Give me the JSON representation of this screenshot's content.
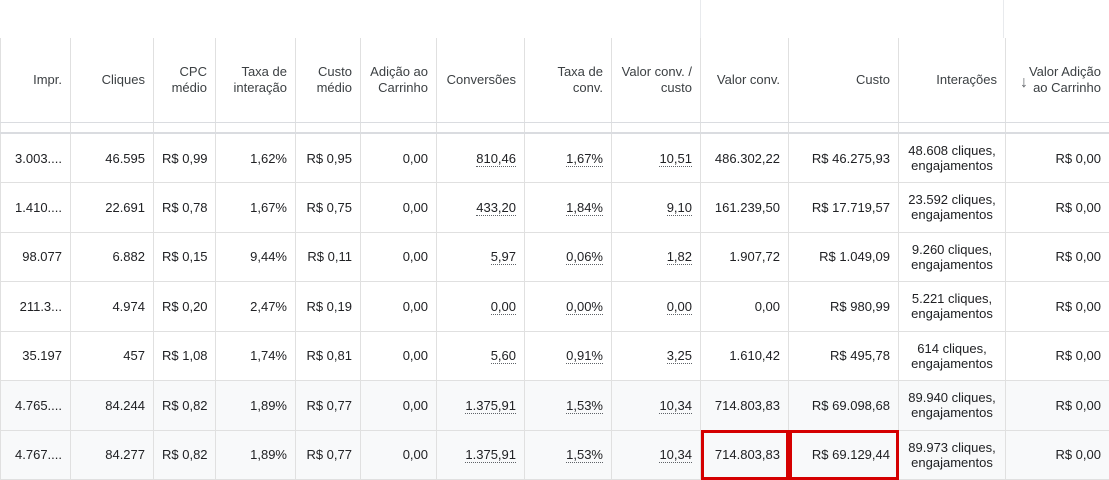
{
  "columns": [
    "Impr.",
    "Cliques",
    "CPC médio",
    "Taxa de interação",
    "Custo médio",
    "Adição ao Carrinho",
    "Conversões",
    "Taxa de conv.",
    "Valor conv. / custo",
    "Valor conv.",
    "Custo",
    "Interações",
    "Valor Adição ao Carrinho"
  ],
  "sort_icon": "arrow-down-icon",
  "rows": [
    {
      "impr": "3.003....",
      "cliques": "46.595",
      "cpc": "R$ 0,99",
      "taxa_interacao": "1,62%",
      "custo_medio": "R$ 0,95",
      "adicao": "0,00",
      "conversoes": "810,46",
      "taxa_conv": "1,67%",
      "valor_custo": "10,51",
      "valor_conv": "486.302,22",
      "custo": "R$ 46.275,93",
      "interacoes": "48.608 cliques, engajamentos",
      "valor_adicao": "R$ 0,00"
    },
    {
      "impr": "1.410....",
      "cliques": "22.691",
      "cpc": "R$ 0,78",
      "taxa_interacao": "1,67%",
      "custo_medio": "R$ 0,75",
      "adicao": "0,00",
      "conversoes": "433,20",
      "taxa_conv": "1,84%",
      "valor_custo": "9,10",
      "valor_conv": "161.239,50",
      "custo": "R$ 17.719,57",
      "interacoes": "23.592 cliques, engajamentos",
      "valor_adicao": "R$ 0,00"
    },
    {
      "impr": "98.077",
      "cliques": "6.882",
      "cpc": "R$ 0,15",
      "taxa_interacao": "9,44%",
      "custo_medio": "R$ 0,11",
      "adicao": "0,00",
      "conversoes": "5,97",
      "taxa_conv": "0,06%",
      "valor_custo": "1,82",
      "valor_conv": "1.907,72",
      "custo": "R$ 1.049,09",
      "interacoes": "9.260 cliques, engajamentos",
      "valor_adicao": "R$ 0,00"
    },
    {
      "impr": "211.3...",
      "cliques": "4.974",
      "cpc": "R$ 0,20",
      "taxa_interacao": "2,47%",
      "custo_medio": "R$ 0,19",
      "adicao": "0,00",
      "conversoes": "0,00",
      "taxa_conv": "0,00%",
      "valor_custo": "0,00",
      "valor_conv": "0,00",
      "custo": "R$ 980,99",
      "interacoes": "5.221 cliques, engajamentos",
      "valor_adicao": "R$ 0,00"
    },
    {
      "impr": "35.197",
      "cliques": "457",
      "cpc": "R$ 1,08",
      "taxa_interacao": "1,74%",
      "custo_medio": "R$ 0,81",
      "adicao": "0,00",
      "conversoes": "5,60",
      "taxa_conv": "0,91%",
      "valor_custo": "3,25",
      "valor_conv": "1.610,42",
      "custo": "R$ 495,78",
      "interacoes": "614 cliques, engajamentos",
      "valor_adicao": "R$ 0,00"
    },
    {
      "impr": "4.765....",
      "cliques": "84.244",
      "cpc": "R$ 0,82",
      "taxa_interacao": "1,89%",
      "custo_medio": "R$ 0,77",
      "adicao": "0,00",
      "conversoes": "1.375,91",
      "taxa_conv": "1,53%",
      "valor_custo": "10,34",
      "valor_conv": "714.803,83",
      "custo": "R$ 69.098,68",
      "interacoes": "89.940 cliques, engajamentos",
      "valor_adicao": "R$ 0,00"
    },
    {
      "impr": "4.767....",
      "cliques": "84.277",
      "cpc": "R$ 0,82",
      "taxa_interacao": "1,89%",
      "custo_medio": "R$ 0,77",
      "adicao": "0,00",
      "conversoes": "1.375,91",
      "taxa_conv": "1,53%",
      "valor_custo": "10,34",
      "valor_conv": "714.803,83",
      "custo": "R$ 69.129,44",
      "interacoes": "89.973 cliques, engajamentos",
      "valor_adicao": "R$ 0,00"
    }
  ],
  "highlight_color": "#d50000"
}
